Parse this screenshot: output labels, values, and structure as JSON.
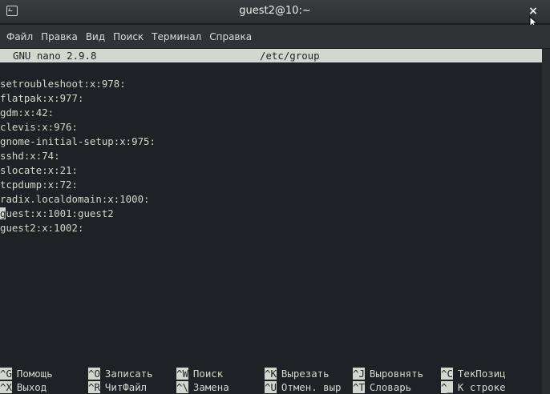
{
  "window": {
    "title": "guest2@10:~",
    "close_glyph": "×"
  },
  "menu": {
    "items": [
      {
        "label": "Файл"
      },
      {
        "label": "Правка"
      },
      {
        "label": "Вид"
      },
      {
        "label": "Поиск"
      },
      {
        "label": "Терминал"
      },
      {
        "label": "Справка"
      }
    ]
  },
  "nano": {
    "version": "GNU nano 2.9.8",
    "filename": "/etc/group"
  },
  "file": {
    "lines": [
      "setroubleshoot:x:978:",
      "flatpak:x:977:",
      "gdm:x:42:",
      "clevis:x:976:",
      "gnome-initial-setup:x:975:",
      "sshd:x:74:",
      "slocate:x:21:",
      "tcpdump:x:72:",
      "radix.localdomain:x:1000:",
      "guest:x:1001:guest2",
      "guest2:x:1002:"
    ],
    "cursor_line_index": 9
  },
  "shortcuts": {
    "row1": [
      {
        "key": "^G",
        "label": "Помощь"
      },
      {
        "key": "^O",
        "label": "Записать"
      },
      {
        "key": "^W",
        "label": "Поиск"
      },
      {
        "key": "^K",
        "label": "Вырезать"
      },
      {
        "key": "^J",
        "label": "Выровнять"
      },
      {
        "key": "^C",
        "label": "ТекПозиц"
      }
    ],
    "row2": [
      {
        "key": "^X",
        "label": "Выход"
      },
      {
        "key": "^R",
        "label": "ЧитФайл"
      },
      {
        "key": "^\\",
        "label": "Замена"
      },
      {
        "key": "^U",
        "label": "Отмен. выр"
      },
      {
        "key": "^T",
        "label": "Словарь"
      },
      {
        "key": "^_",
        "label": "К строке"
      }
    ]
  },
  "colors": {
    "terminal_bg": "#1e2125",
    "terminal_fg": "#d3d7cf",
    "titlebar_bg": "#2d3033",
    "menubar_bg": "#303336"
  }
}
